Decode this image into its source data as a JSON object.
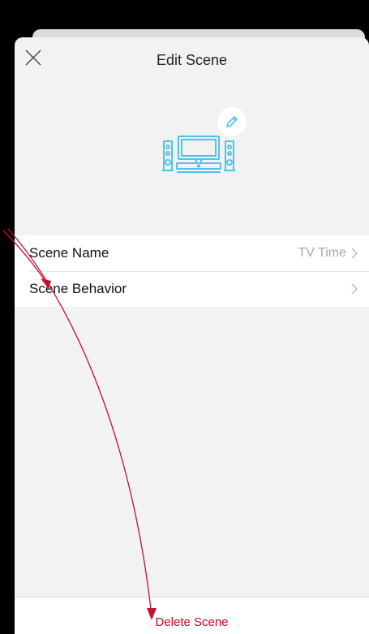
{
  "header": {
    "title": "Edit Scene"
  },
  "icons": {
    "close": "close-icon",
    "scene": "home-theater-icon",
    "edit": "pencil-icon",
    "chevron": "chevron-right-icon"
  },
  "list": {
    "items": [
      {
        "label": "Scene Name",
        "value": "TV Time"
      },
      {
        "label": "Scene Behavior",
        "value": ""
      }
    ]
  },
  "footer": {
    "delete_label": "Delete Scene"
  },
  "colors": {
    "accent": "#4fc3e8",
    "danger": "#d0021b",
    "annotation": "#c8102e"
  }
}
